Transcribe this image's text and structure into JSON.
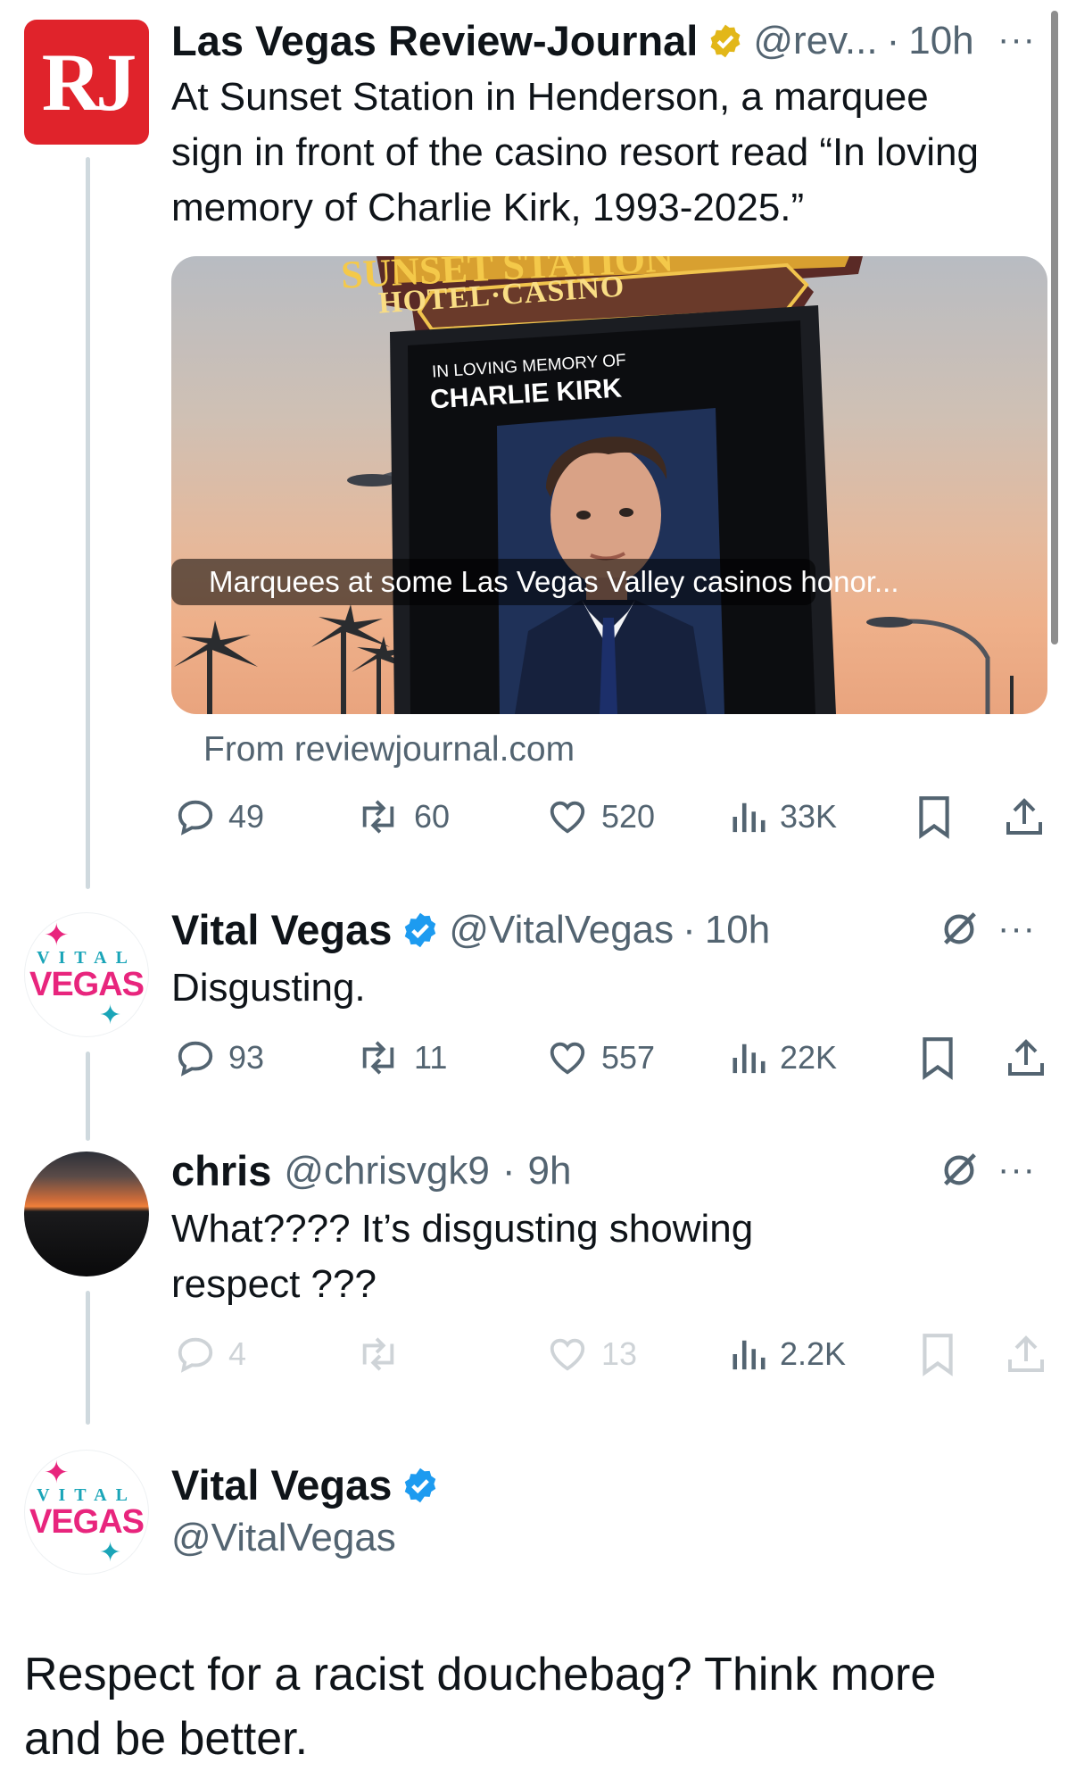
{
  "tweet1": {
    "avatar_text": "RJ",
    "name": "Las Vegas Review-Journal",
    "handle": "@rev...",
    "sep": "·",
    "time": "10h",
    "more": "···",
    "text": "At Sunset Station in Henderson, a marquee sign in front of the casino resort read “In loving memory of Charlie Kirk, 1993-2025.”",
    "card": {
      "sign_top": "SUNSET STATION",
      "sign_sub": "HOTEL·CASINO",
      "screen_line1": "IN LOVING MEMORY OF",
      "screen_line2": "CHARLIE KIRK",
      "caption": "Marquees at some Las Vegas Valley casinos honor...",
      "source": "From reviewjournal.com"
    },
    "actions": {
      "replies": "49",
      "reposts": "60",
      "likes": "520",
      "views": "33K"
    }
  },
  "tweet2": {
    "logo_top": "VITAL",
    "logo_bottom": "VEGAS",
    "name": "Vital Vegas",
    "handle": "@VitalVegas",
    "sep": "·",
    "time": "10h",
    "more": "···",
    "text": "Disgusting.",
    "actions": {
      "replies": "93",
      "reposts": "11",
      "likes": "557",
      "views": "22K"
    }
  },
  "tweet3": {
    "name": "chris",
    "handle": "@chrisvgk9",
    "sep": "·",
    "time": "9h",
    "more": "···",
    "text": "What???? It’s disgusting showing respect ???",
    "actions": {
      "replies": "4",
      "reposts": "",
      "likes": "13",
      "views": "2.2K"
    }
  },
  "tweet4": {
    "logo_top": "VITAL",
    "logo_bottom": "VEGAS",
    "name": "Vital Vegas",
    "handle": "@VitalVegas",
    "text": "Respect for a racist douchebag? Think more and be better."
  },
  "colors": {
    "verified_gold": "#e2b719",
    "verified_blue": "#1d9bf0",
    "rj_red": "#e0232b",
    "vv_pink": "#e8257d",
    "vv_teal": "#1aa5b8"
  }
}
